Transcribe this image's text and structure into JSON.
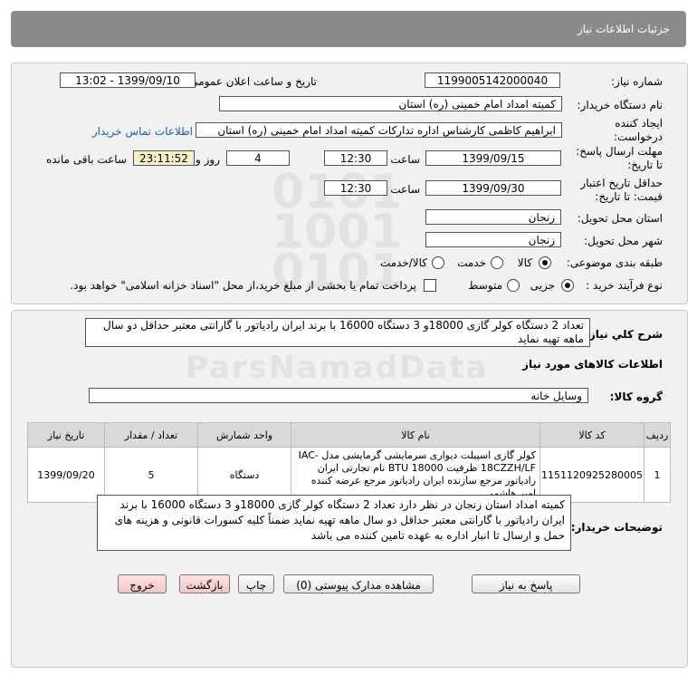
{
  "header": {
    "title": "جزئیات اطلاعات نیاز"
  },
  "form": {
    "need_number_label": "شماره نیاز:",
    "need_number": "1199005142000040",
    "announce_label": "تاریخ و ساعت اعلان عمومی:",
    "announce_value": "1399/09/10 - 13:02",
    "buyer_org_label": "نام دستگاه خریدار:",
    "buyer_org": "کمیته امداد امام خمینی (ره) استان",
    "creator_label": "ایجاد کننده درخواست:",
    "creator": "ابراهیم  کاظمی  کارشناس اداره تدارکات   کمیته امداد امام خمینی (ره) استان",
    "contact_link": "اطلاعات تماس خریدار",
    "reply_deadline_label": "مهلت ارسال پاسخ: تا تاریخ:",
    "reply_date": "1399/09/15",
    "time_label": "ساعت",
    "reply_time": "12:30",
    "days_value": "4",
    "days_label": "روز و",
    "remaining_time": "23:11:52",
    "remaining_label": "ساعت باقی مانده",
    "validity_label": "حداقل تاریخ اعتبار قیمت: تا تاریخ:",
    "validity_date": "1399/09/30",
    "validity_time": "12:30",
    "province_label": "استان محل تحویل:",
    "province": "زنجان",
    "city_label": "شهر محل تحویل:",
    "city": "زنجان",
    "category_label": "طبقه بندی موضوعی:",
    "category_options": [
      "کالا",
      "خدمت",
      "کالا/خدمت"
    ],
    "process_label": "نوع فرآیند خرید :",
    "process_options": [
      "جزیی",
      "متوسط"
    ],
    "payment_note": "پرداخت تمام یا بخشی از مبلغ خرید،از محل \"اسناد خزانه اسلامی\" خواهد بود."
  },
  "summary": {
    "label": "شرح کلي نياز:",
    "text": "تعداد 2 دستگاه کولر گازی   18000و 3 دستگاه 16000  با برند ایران رادیاتور  با گارانتی معتبر حداقل دو سال ماهه تهیه نماید",
    "goods_info_title": "اطلاعات کالاهای مورد نیاز",
    "group_label": "گروه کالا:",
    "group_value": "وسایل خانه"
  },
  "table": {
    "headers": [
      "ردیف",
      "کد کالا",
      "نام کالا",
      "واحد شمارش",
      "تعداد / مقدار",
      "تاریخ نیاز"
    ],
    "rows": [
      {
        "row": "1",
        "code": "1151120925280005",
        "name": "کولر گازی اسپیلت دیواری سرمایشی گرمایشی مدل -IAC 18CZZH/LF ظرفیت BTU 18000 نام تجارتی ایران رادیاتور مرجع سازنده ایران رادیاتور مرجع عرضه کننده امیر هاشمی",
        "unit": "دستگاه",
        "qty": "5",
        "date": "1399/09/20"
      }
    ]
  },
  "buyer_notes": {
    "label": "توضیحات خریدار:",
    "text": "کمیته امداد استان زنجان در نظر دارد تعداد 2 دستگاه کولر گازی 18000و 3 دستگاه 16000 با برند ایران رادیاتور با گارانتی معتبر حداقل دو سال ماهه تهیه نماید ضمناً کلیه کسورات قانونی و هزینه های حمل و ارسال تا انبار اداره به عهده تامین کننده می باشد"
  },
  "buttons": {
    "reply": "پاسخ به نیاز",
    "attachments": "مشاهده مدارک پیوستی (0)",
    "print": "چاپ",
    "back": "بازگشت",
    "exit": "خروج"
  },
  "colors": {
    "title_bar": "#8a8a8a",
    "panel": "#f1f1f1",
    "remaining_bg": "#f6f4c8",
    "link": "#1a5fb4",
    "red_button": "#f4c6c6"
  }
}
